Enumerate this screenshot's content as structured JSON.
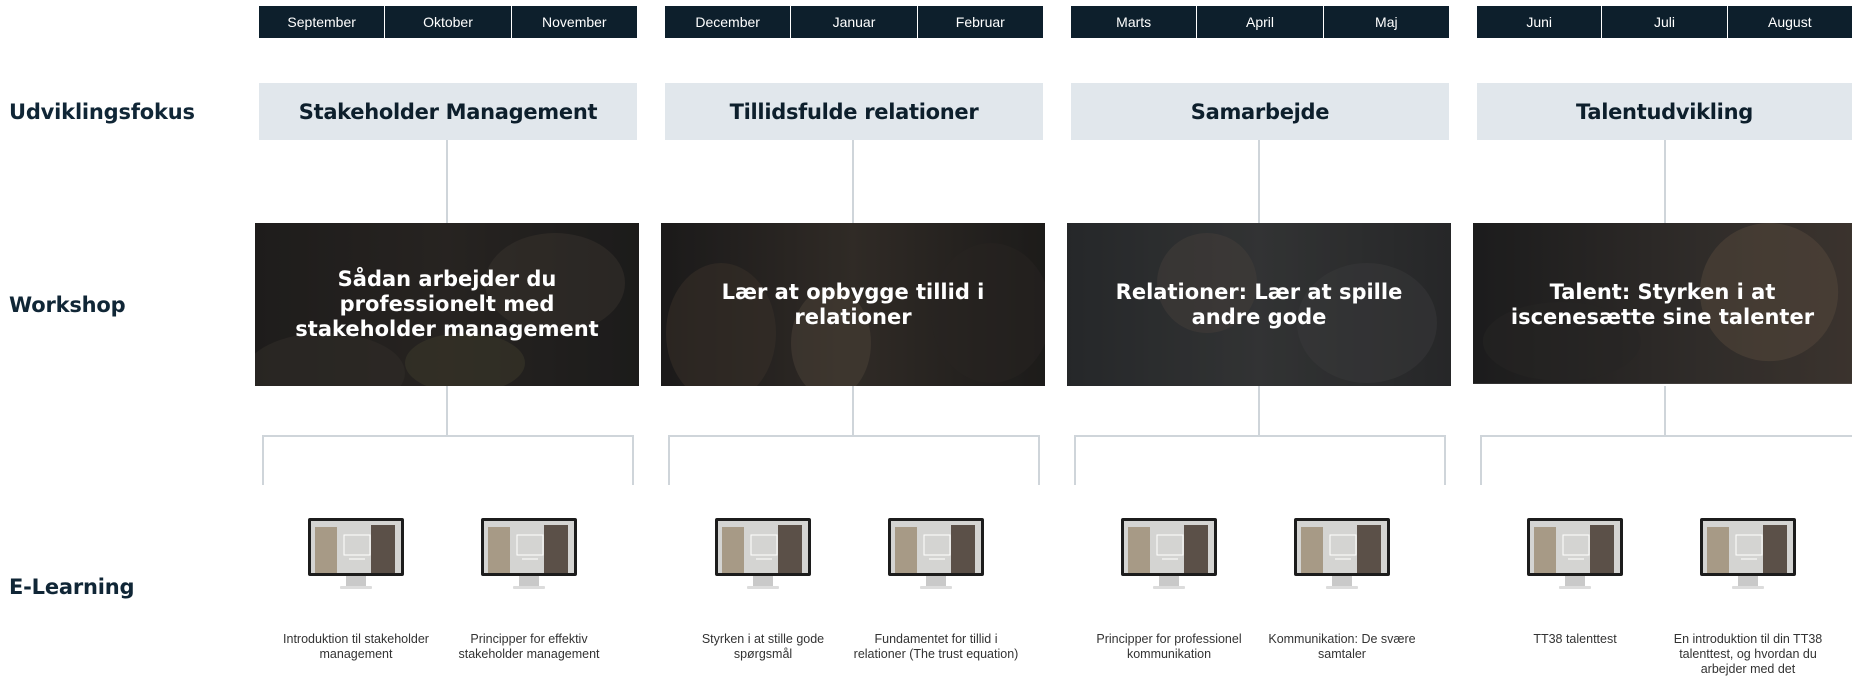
{
  "row_labels": {
    "focus": "Udviklingsfokus",
    "workshop": "Workshop",
    "elearning": "E-Learning"
  },
  "columns": [
    {
      "months": [
        "September",
        "Oktober",
        "November"
      ],
      "focus": "Stakeholder Management",
      "workshop": "Sådan arbejder du professionelt med stakeholder management",
      "courses": [
        "Introduktion til stakeholder management",
        "Principper for effektiv stakeholder management"
      ]
    },
    {
      "months": [
        "December",
        "Januar",
        "Februar"
      ],
      "focus": "Tillidsfulde relationer",
      "workshop": "Lær at opbygge tillid i relationer",
      "courses": [
        "Styrken i at stille gode spørgsmål",
        "Fundamentet for tillid i relationer (The trust equation)"
      ]
    },
    {
      "months": [
        "Marts",
        "April",
        "Maj"
      ],
      "focus": "Samarbejde",
      "workshop": "Relationer: Lær at spille andre gode",
      "courses": [
        "Principper for professionel kommunikation",
        "Kommunikation: De svære samtaler"
      ]
    },
    {
      "months": [
        "Juni",
        "Juli",
        "August"
      ],
      "focus": "Talentudvikling",
      "workshop": "Talent: Styrken i at iscenesætte sine talenter",
      "courses": [
        "TT38 talenttest",
        "En introduktion til din TT38 talenttest, og hvordan du arbejder med det"
      ]
    }
  ],
  "colors": {
    "month_bar": "#0d1f2c",
    "focus_box": "#e1e7ec",
    "connector": "#cfd5da",
    "heading": "#102636"
  },
  "icons": {
    "course_thumbnail": "monitor-icon"
  }
}
